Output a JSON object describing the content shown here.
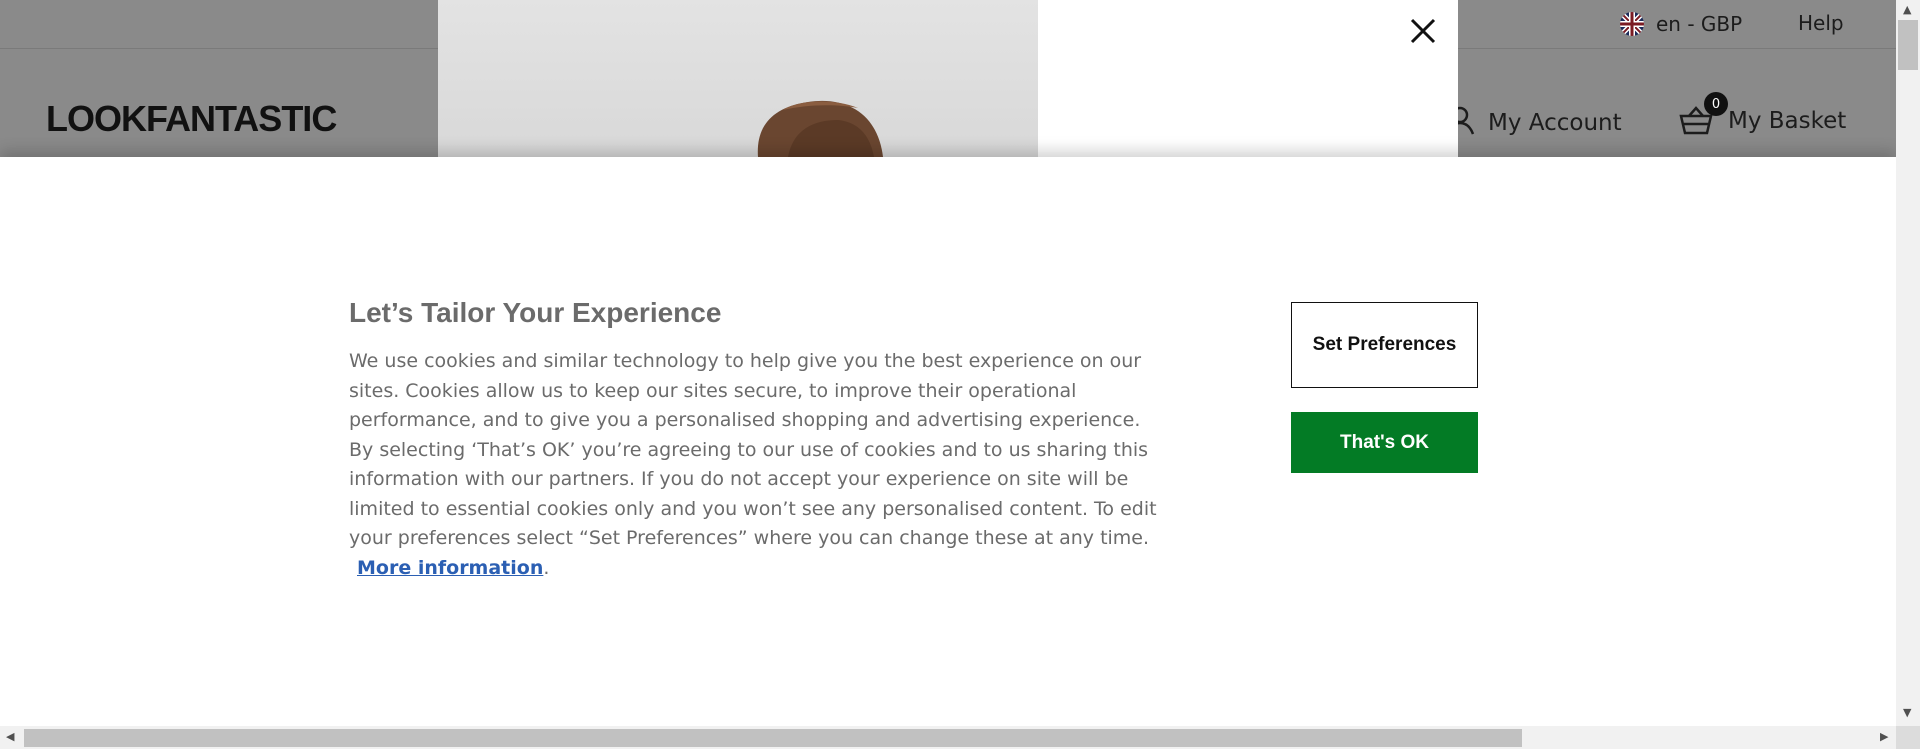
{
  "site": {
    "logo": "LOOKFANTASTIC",
    "locale_label": "en - GBP",
    "help_label": "Help",
    "account_label": "My Account",
    "basket_label": "My Basket",
    "basket_count": "0"
  },
  "cookie_banner": {
    "title": "Let’s Tailor Your Experience",
    "body": "We use cookies and similar technology to help give you the best experience on our sites. Cookies allow us to keep our sites secure, to improve their operational performance, and to give you a personalised shopping and advertising experience. By selecting ‘That’s OK’ you’re agreeing to our use of cookies and to us sharing this information with our partners. If you do not accept your experience on site will be limited to essential cookies only and you won’t see any personalised content. To edit your preferences select “Set Preferences” where you can change these at any time.",
    "more_info_label": "More information",
    "period": ".",
    "set_preferences_label": "Set Preferences",
    "accept_label": "That's OK"
  },
  "colors": {
    "accept_button": "#037b25",
    "link": "#2b5fb3",
    "overlay": "#8a8a8a"
  },
  "icons": {
    "flag": "uk-flag-icon",
    "account": "user-icon",
    "basket": "basket-icon",
    "close": "close-icon"
  }
}
